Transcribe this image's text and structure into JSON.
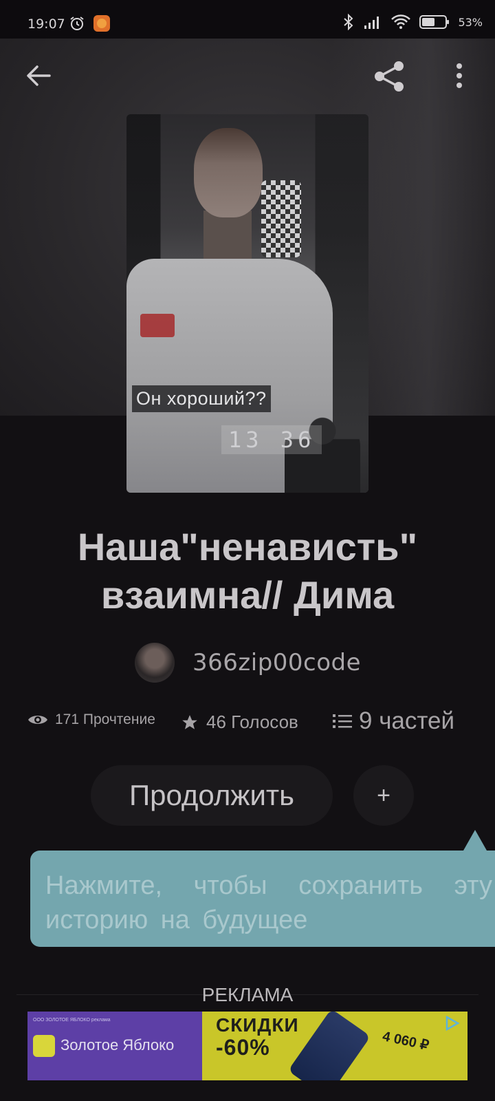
{
  "status_bar": {
    "time": "19:07",
    "battery": "53%",
    "icons": [
      "alarm-icon",
      "app-notification-icon",
      "bluetooth-icon",
      "signal-icon",
      "wifi-icon",
      "battery-icon"
    ]
  },
  "toolbar": {
    "back_icon": "arrow-left-icon",
    "share_icon": "share-icon",
    "more_icon": "more-vertical-icon"
  },
  "cover": {
    "caption": "Он хороший??",
    "time_overlay": "13 36"
  },
  "story": {
    "title": "Наша\"ненависть\" взаимна//  Дима",
    "author": "366zip00code",
    "reads": "171 Прочтение",
    "votes": "46 Голосов",
    "parts": "9 частей"
  },
  "actions": {
    "continue_label": "Продолжить",
    "add_label": "+"
  },
  "tooltip": {
    "text": "Нажмите, чтобы сохранить эту историю на будущее"
  },
  "ad": {
    "label": "РЕКЛАМА",
    "small_text": "ООО ЗОЛОТОЕ ЯБЛОКО реклама",
    "brand": "Золотое Яблоко",
    "headline": "СКИДКИ",
    "discount": "-60%",
    "price": "4 060 ₽"
  },
  "colors": {
    "background": "#121013",
    "tooltip": "#74a6ae",
    "ad_purple": "#5d3fa6",
    "ad_yellow": "#c9c629"
  }
}
